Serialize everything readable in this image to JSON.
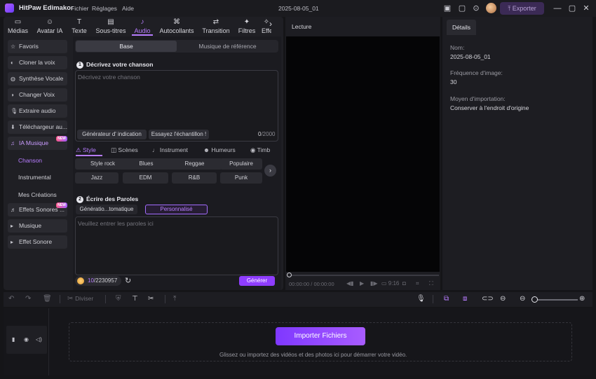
{
  "app": {
    "name": "HitPaw Edimakor",
    "menu": [
      "Fichier",
      "Réglages",
      "Aide"
    ],
    "doc_title": "2025-08-05_01",
    "export_label": "Exporter"
  },
  "tabs": [
    {
      "label": "Médias",
      "icon": "folder-icon"
    },
    {
      "label": "Avatar IA",
      "icon": "avatar-icon"
    },
    {
      "label": "Texte",
      "icon": "text-icon"
    },
    {
      "label": "Sous-titres",
      "icon": "subtitle-icon"
    },
    {
      "label": "Audio",
      "icon": "music-note-icon"
    },
    {
      "label": "Autocollants",
      "icon": "sticker-icon"
    },
    {
      "label": "Transition",
      "icon": "transition-icon"
    },
    {
      "label": "Filtres",
      "icon": "filter-icon"
    },
    {
      "label": "Effe",
      "icon": "effects-icon"
    }
  ],
  "sidebar": {
    "items": [
      {
        "label": "Favoris",
        "icon": "star-icon"
      },
      {
        "label": "Cloner la voix",
        "icon": "clone-voice-icon"
      },
      {
        "label": "Synthèse Vocale",
        "icon": "tts-icon"
      },
      {
        "label": "Changer Voix",
        "icon": "voice-change-icon"
      },
      {
        "label": "Extraire audio",
        "icon": "mic-icon"
      },
      {
        "label": "Téléchargeur au...",
        "icon": "download-icon"
      },
      {
        "label": "IA Musique",
        "icon": "ai-music-icon"
      },
      {
        "label": "Effets Sonores ...",
        "icon": "sound-effects-icon"
      },
      {
        "label": "Musique",
        "icon": "caret-right-icon"
      },
      {
        "label": "Effet Sonore",
        "icon": "caret-right-icon"
      }
    ],
    "sub_items": [
      "Chanson",
      "Instrumental",
      "Mes Créations"
    ],
    "new_badge": "NEW"
  },
  "music": {
    "seg_base": "Base",
    "seg_ref": "Musique de référence",
    "step1_num": "1",
    "step1_title": "Décrivez votre chanson",
    "desc_placeholder": "Décrivez votre chanson",
    "chip_generator": "Générateur d' indication",
    "chip_sample": "Essayez l'échantillon !",
    "count_current": "0",
    "count_max": "/2000",
    "style_tabs": [
      "Style",
      "Scènes",
      "Instrument",
      "Humeurs",
      "Timb"
    ],
    "tags": [
      "Style rock",
      "Blues",
      "Reggae",
      "Populaire",
      "Jazz",
      "EDM",
      "R&B",
      "Punk"
    ],
    "step2_num": "2",
    "step2_title": "Écrire des Paroles",
    "lyrics_auto": "Génératio...tomatique",
    "lyrics_custom": "Personnalisé",
    "lyrics_placeholder": "Veuillez entrer les paroles ici",
    "credits_used": "10",
    "credits_total": "/2230957",
    "generate_label": "Générer"
  },
  "preview": {
    "title": "Lecture",
    "time": "00:00:00 / 00:00:00",
    "ratio": "9:16"
  },
  "details": {
    "tab": "Détails",
    "fields": [
      {
        "label": "Nom:",
        "value": "2025-08-05_01"
      },
      {
        "label": "Fréquence d'image:",
        "value": "30"
      },
      {
        "label": "Moyen d'importation:",
        "value": "Conserver à l'endroit d'origine"
      }
    ]
  },
  "timeline": {
    "split_label": "Diviser",
    "import_label": "Importer Fichiers",
    "drop_hint": "Glissez ou importez des vidéos et des photos ici pour démarrer votre vidéo."
  },
  "colors": {
    "accent": "#b77cff",
    "button": "#8f3dff",
    "bg": "#151518"
  }
}
